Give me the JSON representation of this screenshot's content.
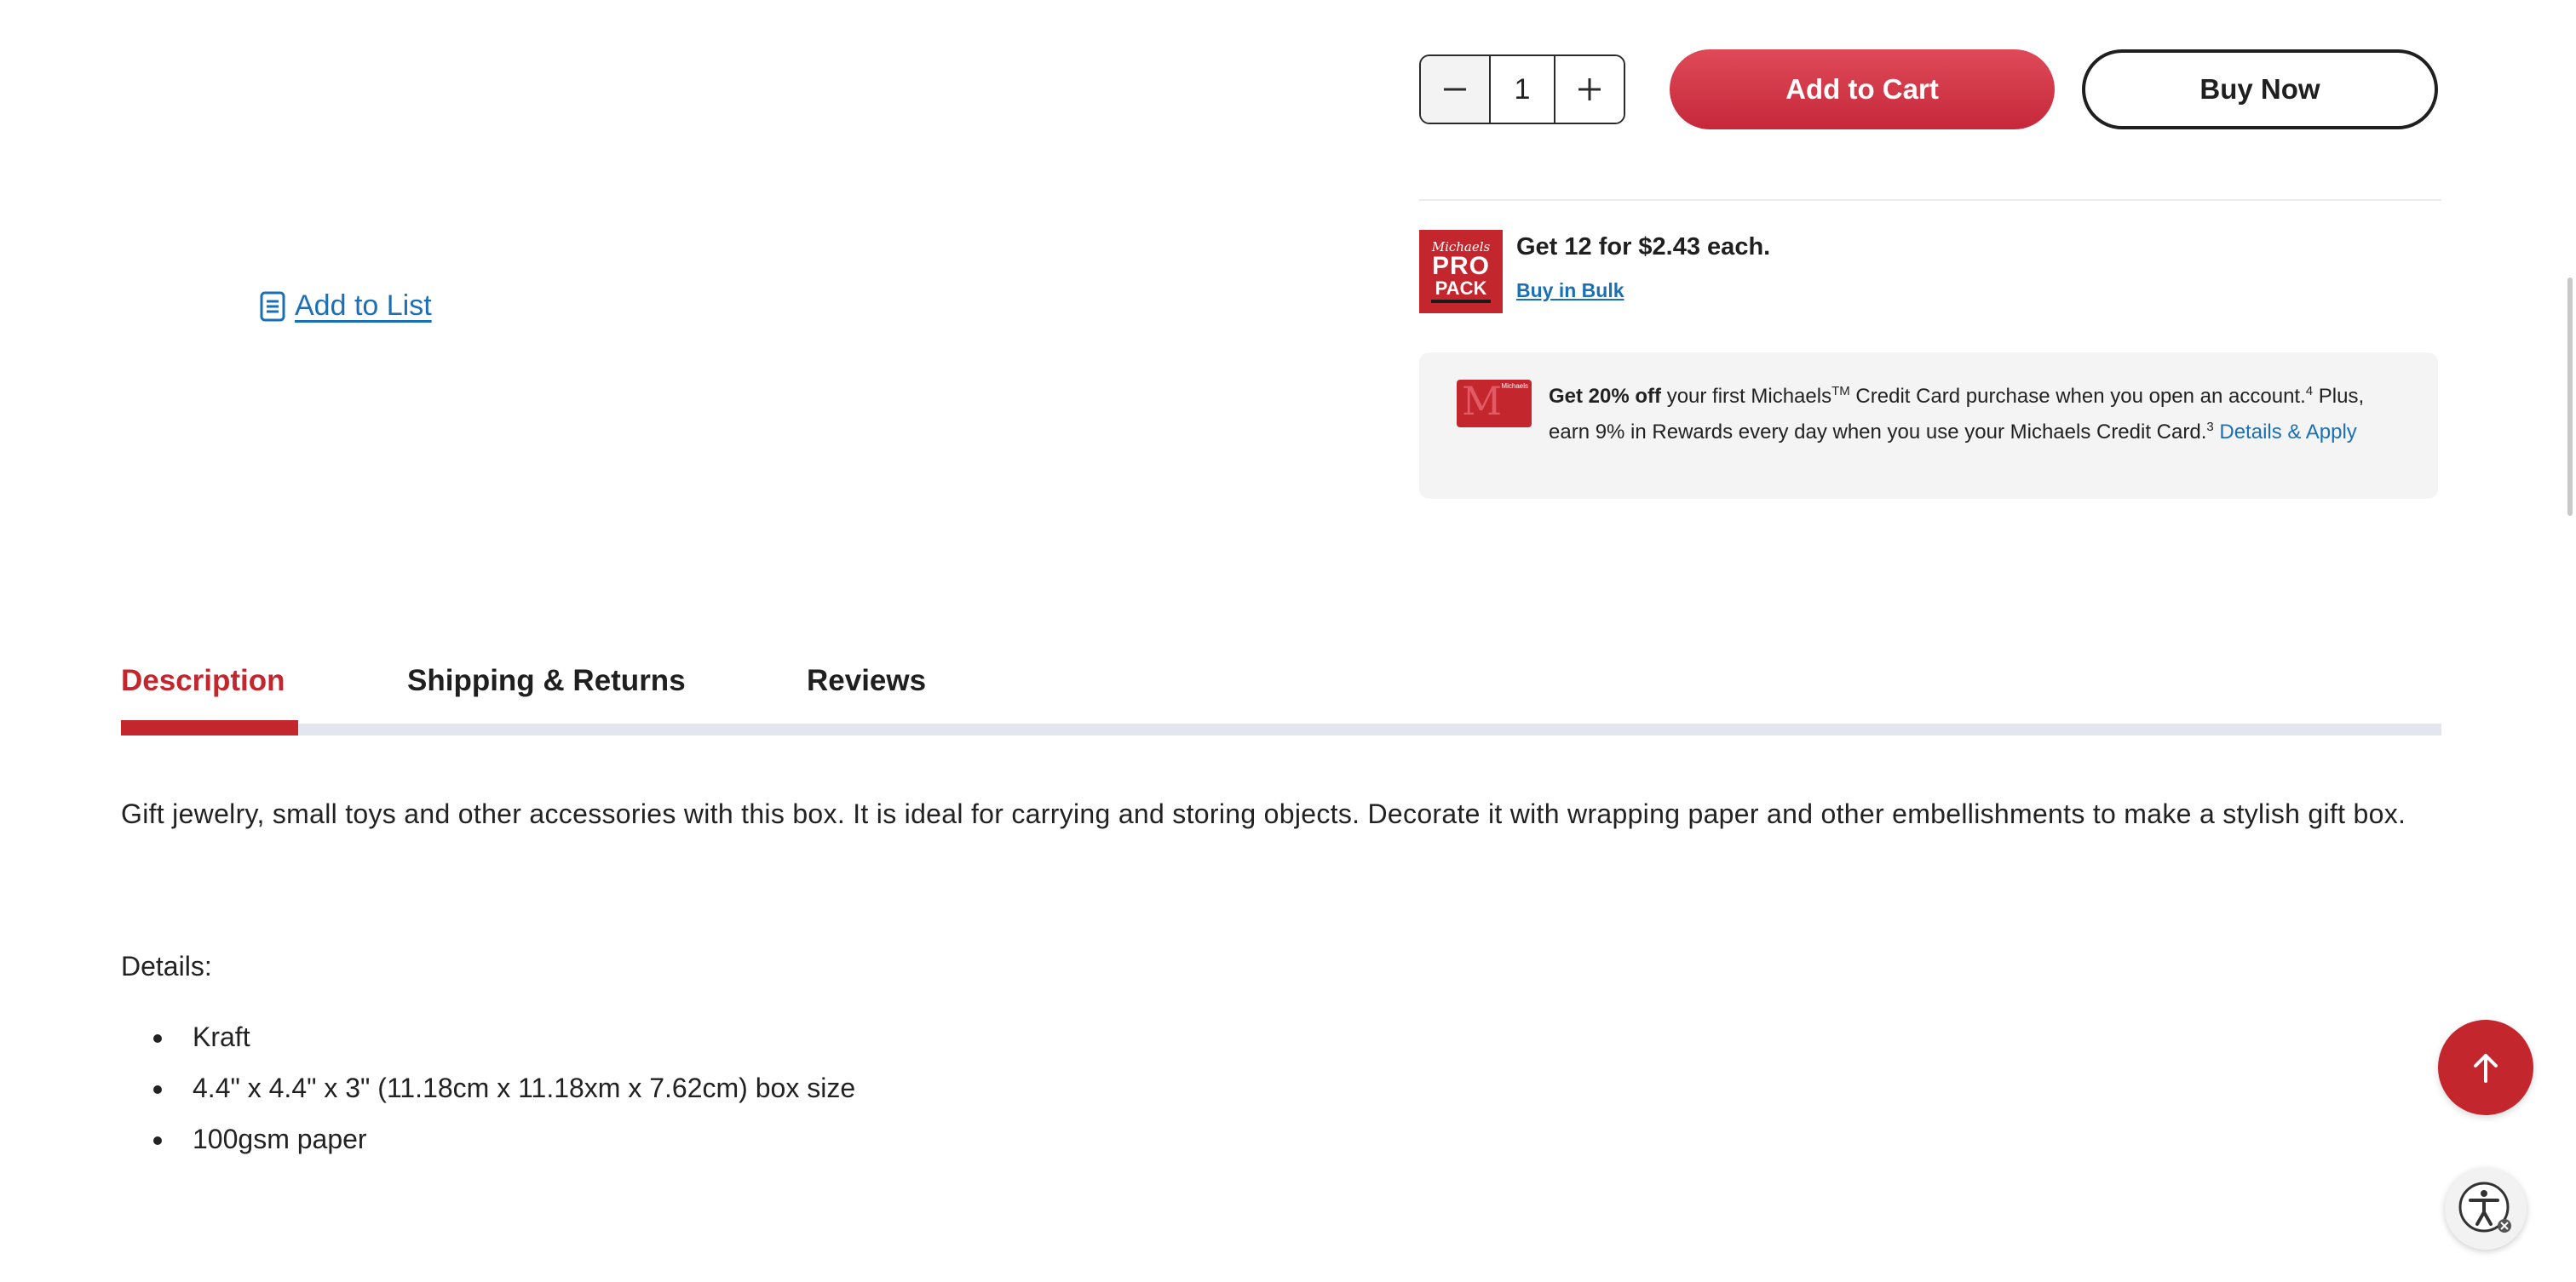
{
  "add_to_list": {
    "label": "Add to List",
    "icon": "list-icon"
  },
  "quantity": {
    "value": "1",
    "minus_icon": "minus-icon",
    "plus_icon": "plus-icon"
  },
  "buttons": {
    "add_to_cart": "Add to Cart",
    "buy_now": "Buy Now"
  },
  "pro_pack": {
    "logo_brand": "Michaels",
    "logo_line1": "PRO",
    "logo_line2": "PACK",
    "headline": "Get 12 for $2.43 each.",
    "link": "Buy in Bulk"
  },
  "credit_promo": {
    "card_tag": "Michaels",
    "bold_lead": "Get 20% off",
    "text_1": " your first Michaels",
    "tm": "TM",
    "text_2": " Credit Card purchase when you open an account.",
    "sup_1": "4",
    "text_3": " Plus, earn 9% in Rewards every day when you use your Michaels Credit Card.",
    "sup_2": "3",
    "link": "Details & Apply"
  },
  "tabs": [
    {
      "label": "Description",
      "active": true
    },
    {
      "label": "Shipping & Returns",
      "active": false
    },
    {
      "label": "Reviews",
      "active": false
    }
  ],
  "description": {
    "body": "Gift jewelry, small toys and other accessories with this box. It is ideal for carrying and storing objects. Decorate it with wrapping paper and other embellishments to make a stylish gift box.",
    "details_label": "Details:",
    "details": [
      "Kraft",
      "4.4\" x 4.4\" x 3\" (11.18cm x 11.18xm x 7.62cm) box size",
      "100gsm paper"
    ]
  },
  "floating": {
    "back_to_top_icon": "arrow-up-icon",
    "accessibility_icon": "accessibility-icon"
  },
  "colors": {
    "brand_red": "#c4262e",
    "link_blue": "#1b6fb5",
    "tab_track": "#e3e6ec",
    "promo_bg": "#f4f4f4"
  }
}
